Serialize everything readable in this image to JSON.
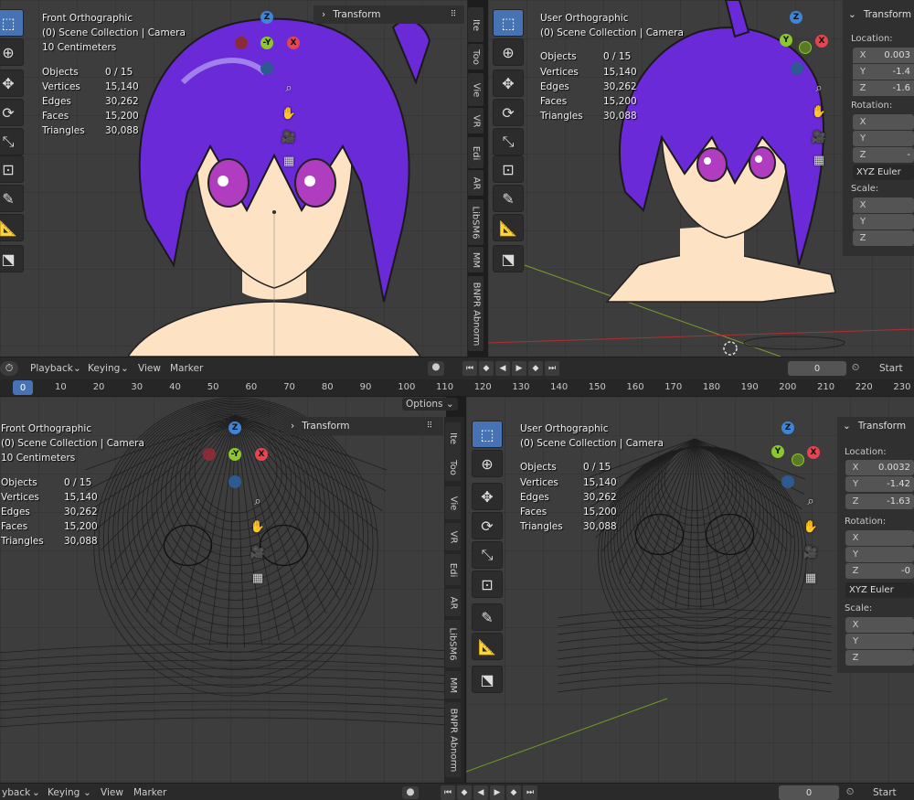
{
  "viewports": [
    {
      "view": "Front Orthographic",
      "collection": "(0) Scene Collection | Camera",
      "scale": "10 Centimeters",
      "stats": [
        [
          "Objects",
          "0 / 15"
        ],
        [
          "Vertices",
          "15,140"
        ],
        [
          "Edges",
          "30,262"
        ],
        [
          "Faces",
          "15,200"
        ],
        [
          "Triangles",
          "30,088"
        ]
      ]
    },
    {
      "view": "User Orthographic",
      "collection": "(0) Scene Collection | Camera",
      "scale": "",
      "stats": [
        [
          "Objects",
          "0 / 15"
        ],
        [
          "Vertices",
          "15,140"
        ],
        [
          "Edges",
          "30,262"
        ],
        [
          "Faces",
          "15,200"
        ],
        [
          "Triangles",
          "30,088"
        ]
      ]
    },
    {
      "view": "Front Orthographic",
      "collection": "(0) Scene Collection | Camera",
      "scale": "10 Centimeters",
      "stats": [
        [
          "Objects",
          "0 / 15"
        ],
        [
          "Vertices",
          "15,140"
        ],
        [
          "Edges",
          "30,262"
        ],
        [
          "Faces",
          "15,200"
        ],
        [
          "Triangles",
          "30,088"
        ]
      ]
    },
    {
      "view": "User Orthographic",
      "collection": "(0) Scene Collection | Camera",
      "scale": "",
      "stats": [
        [
          "Objects",
          "0 / 15"
        ],
        [
          "Vertices",
          "15,140"
        ],
        [
          "Edges",
          "30,262"
        ],
        [
          "Faces",
          "15,200"
        ],
        [
          "Triangles",
          "30,088"
        ]
      ]
    }
  ],
  "gizmo_axes": {
    "z": "Z",
    "y": "Y",
    "x": "X",
    "neg_y": "-Y"
  },
  "sidebar_tabs": [
    "Ite",
    "Too",
    "Vie",
    "VR",
    "Edi",
    "AR",
    "LibSM6",
    "MM",
    "BNPR Abnorm"
  ],
  "transform_panel": {
    "title": "Transform",
    "location_label": "Location:",
    "rotation_label": "Rotation:",
    "scale_label": "Scale:",
    "rotation_mode": "XYZ Euler",
    "location_top": [
      "0.003",
      "-1.4",
      "-1.6"
    ],
    "location_bottom": [
      "0.0032",
      "-1.42",
      "-1.63"
    ],
    "rotation_top": [
      "",
      "",
      "-"
    ],
    "rotation_bottom": [
      "",
      "",
      "-0"
    ],
    "axes": [
      "X",
      "Y",
      "Z"
    ]
  },
  "timeline": {
    "playback": "Playback",
    "keying": "Keying",
    "view": "View",
    "marker": "Marker",
    "frame": "0",
    "start": "Start",
    "options": "Options"
  },
  "bottom_timeline": {
    "playback": "yback",
    "keying": "Keying",
    "view": "View",
    "marker": "Marker",
    "frame": "0",
    "start": "Start"
  },
  "ruler": {
    "current": "0",
    "ticks": [
      "10",
      "20",
      "30",
      "40",
      "50",
      "60",
      "70",
      "80",
      "90",
      "100",
      "110",
      "120",
      "130",
      "140",
      "150",
      "160",
      "170",
      "180",
      "190",
      "200",
      "210",
      "220",
      "230"
    ]
  },
  "colors": {
    "hair": "#6a2ad8",
    "skin": "#fde3c4",
    "accent": "#4772b3",
    "x": "#e8434e",
    "y": "#8bc72e",
    "z": "#3d85d6"
  }
}
